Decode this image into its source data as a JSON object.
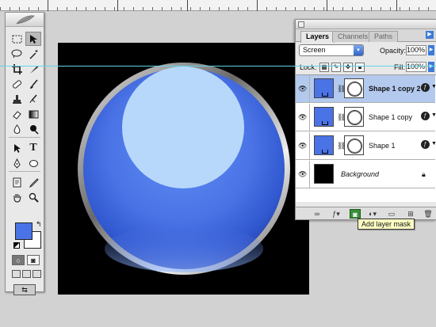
{
  "layers_panel": {
    "tabs": [
      {
        "label": "Layers"
      },
      {
        "label": "Channels"
      },
      {
        "label": "Paths"
      }
    ],
    "blend_mode": "Screen",
    "opacity_label": "Opacity:",
    "opacity_value": "100%",
    "lock_label": "Lock:",
    "fill_label": "Fill:",
    "fill_value": "100%",
    "layers": [
      {
        "name": "Shape 1 copy 2",
        "selected": true
      },
      {
        "name": "Shape 1 copy",
        "selected": false
      },
      {
        "name": "Shape 1",
        "selected": false
      },
      {
        "name": "Background",
        "selected": false
      }
    ],
    "tooltip": "Add layer mask"
  },
  "colors": {
    "foreground": "#4a73e6",
    "background": "#ffffff",
    "guide": "#5fd6e6",
    "selection": "#b3c9ee"
  },
  "icons": [
    "feather-icon",
    "marquee-icon",
    "move-icon",
    "lasso-icon",
    "magic-wand-icon",
    "crop-icon",
    "slice-icon",
    "healing-icon",
    "brush-icon",
    "stamp-icon",
    "history-brush-icon",
    "eraser-icon",
    "gradient-icon",
    "blur-icon",
    "dodge-icon",
    "path-select-icon",
    "type-icon",
    "pen-icon",
    "shape-icon",
    "notes-icon",
    "eyedropper-icon",
    "hand-icon",
    "zoom-icon",
    "eye-icon",
    "link-icon",
    "fx-icon",
    "lock-icon",
    "add-mask-icon",
    "trash-icon"
  ]
}
